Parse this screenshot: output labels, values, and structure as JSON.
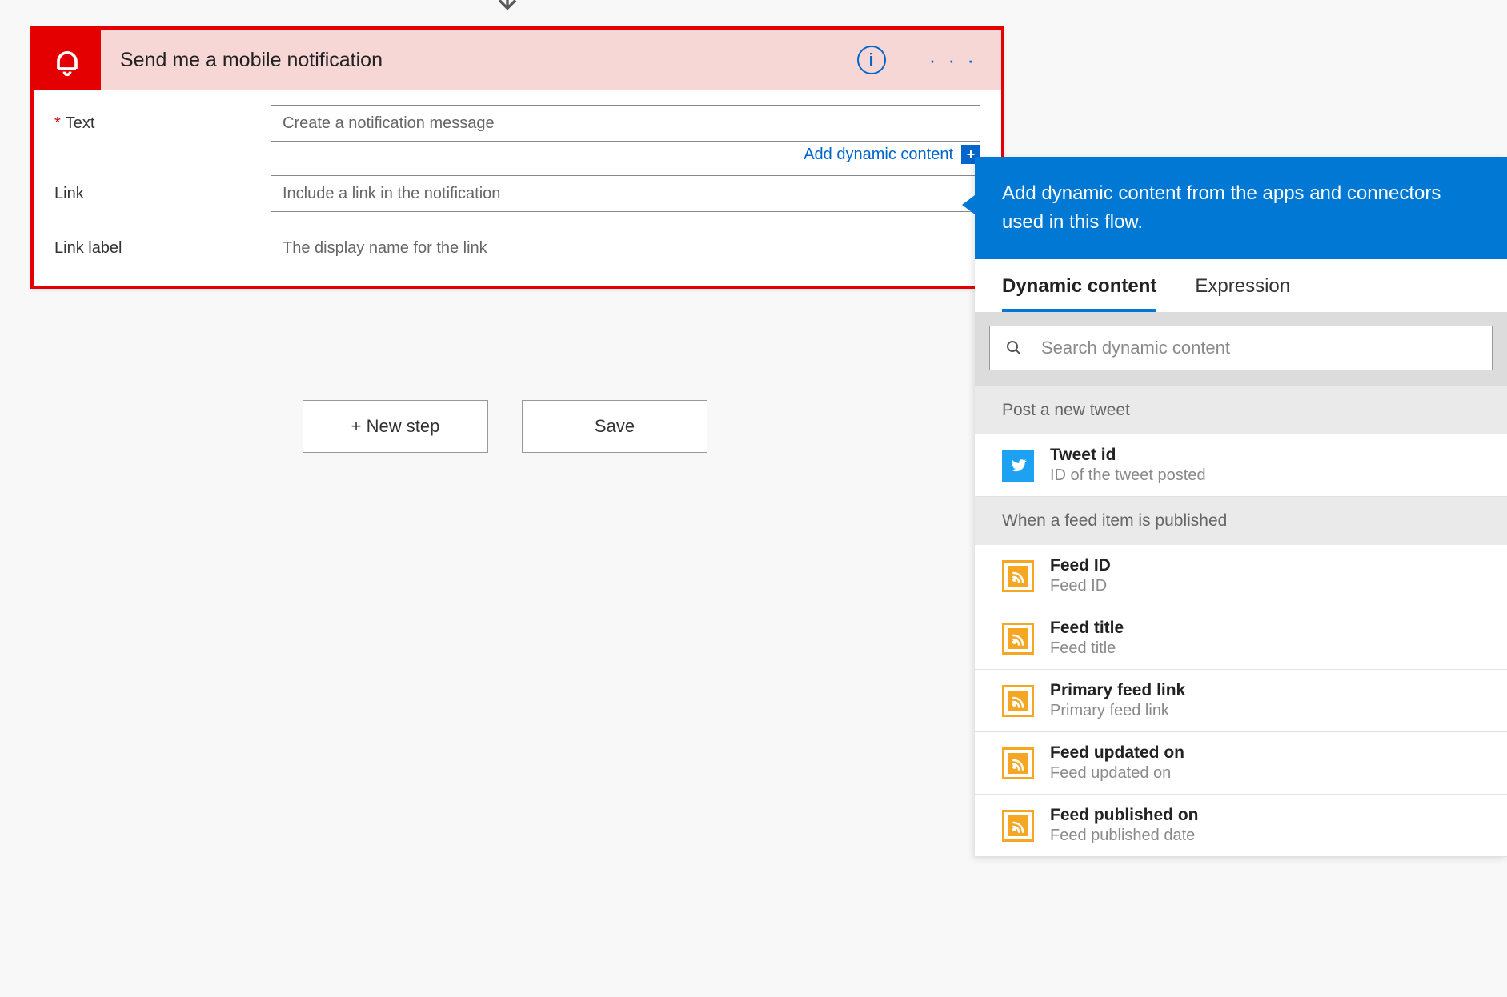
{
  "card": {
    "title": "Send me a mobile notification",
    "fields": {
      "text": {
        "label": "Text",
        "required": true,
        "placeholder": "Create a notification message"
      },
      "link": {
        "label": "Link",
        "required": false,
        "placeholder": "Include a link in the notification"
      },
      "label": {
        "label": "Link label",
        "required": false,
        "placeholder": "The display name for the link"
      }
    },
    "add_dynamic": "Add dynamic content"
  },
  "buttons": {
    "new_step": "+ New step",
    "save": "Save"
  },
  "panel": {
    "intro": "Add dynamic content from the apps and connectors used in this flow.",
    "tabs": {
      "dynamic": "Dynamic content",
      "expression": "Expression"
    },
    "search_placeholder": "Search dynamic content",
    "groups": [
      {
        "title": "Post a new tweet",
        "icon": "twitter",
        "items": [
          {
            "name": "Tweet id",
            "desc": "ID of the tweet posted"
          }
        ]
      },
      {
        "title": "When a feed item is published",
        "icon": "rss",
        "items": [
          {
            "name": "Feed ID",
            "desc": "Feed ID"
          },
          {
            "name": "Feed title",
            "desc": "Feed title"
          },
          {
            "name": "Primary feed link",
            "desc": "Primary feed link"
          },
          {
            "name": "Feed updated on",
            "desc": "Feed updated on"
          },
          {
            "name": "Feed published on",
            "desc": "Feed published date"
          }
        ]
      }
    ]
  }
}
